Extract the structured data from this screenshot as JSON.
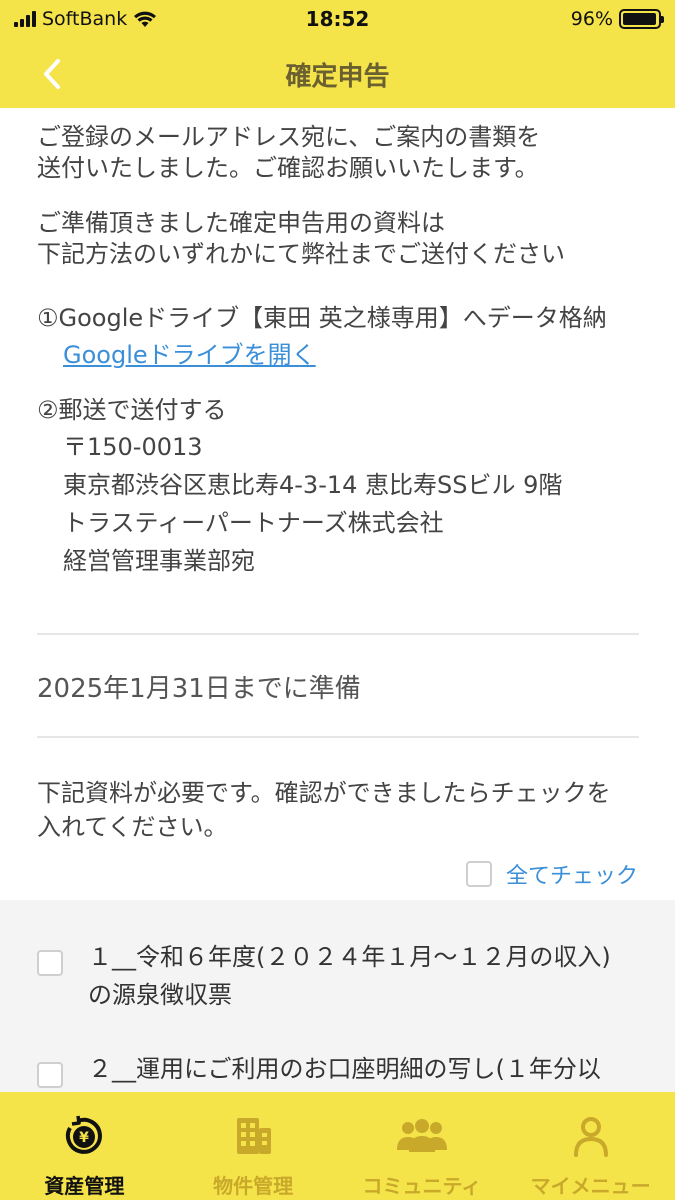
{
  "status": {
    "carrier": "SoftBank",
    "time": "18:52",
    "battery_text": "96%",
    "battery_level": 0.96
  },
  "nav": {
    "title": "確定申告"
  },
  "body": {
    "para1_line1": "ご登録のメールアドレス宛に、ご案内の書類を",
    "para1_line2": "送付いたしました。ご確認お願いいたします。",
    "para2_line1": "ご準備頂きました確定申告用の資料は",
    "para2_line2": "下記方法のいずれかにて弊社までご送付ください",
    "method1": "①Googleドライブ【東田 英之様専用】へデータ格納",
    "method1_link": "Googleドライブを開く",
    "method2": "②郵送で送付する",
    "address": {
      "postal": "〒150-0013",
      "street": "東京都渋谷区恵比寿4-3-14 恵比寿SSビル 9階",
      "company": "トラスティーパートナーズ株式会社",
      "department": "経営管理事業部宛"
    },
    "deadline": "2025年1月31日までに準備",
    "instruction_line1": "下記資料が必要です。確認ができましたらチェックを",
    "instruction_line2": "入れてください。",
    "check_all_label": "全てチェック"
  },
  "checklist": [
    {
      "line1": "１__令和６年度(２０２４年１月〜１２月の収入)",
      "line2": "の源泉徴収票",
      "checked": false
    },
    {
      "line1": "２__運用にご利用のお口座明細の写し(１年分以",
      "line2": "",
      "checked": false
    }
  ],
  "tabs": [
    {
      "label": "資産管理",
      "icon": "yen-cycle-icon",
      "active": true
    },
    {
      "label": "物件管理",
      "icon": "building-icon",
      "active": false
    },
    {
      "label": "コミュニティ",
      "icon": "people-icon",
      "active": false
    },
    {
      "label": "マイメニュー",
      "icon": "person-icon",
      "active": false
    }
  ],
  "colors": {
    "brand_yellow": "#f5e34a",
    "link_blue": "#3a8fd8",
    "tab_inactive": "#c8a92a"
  }
}
